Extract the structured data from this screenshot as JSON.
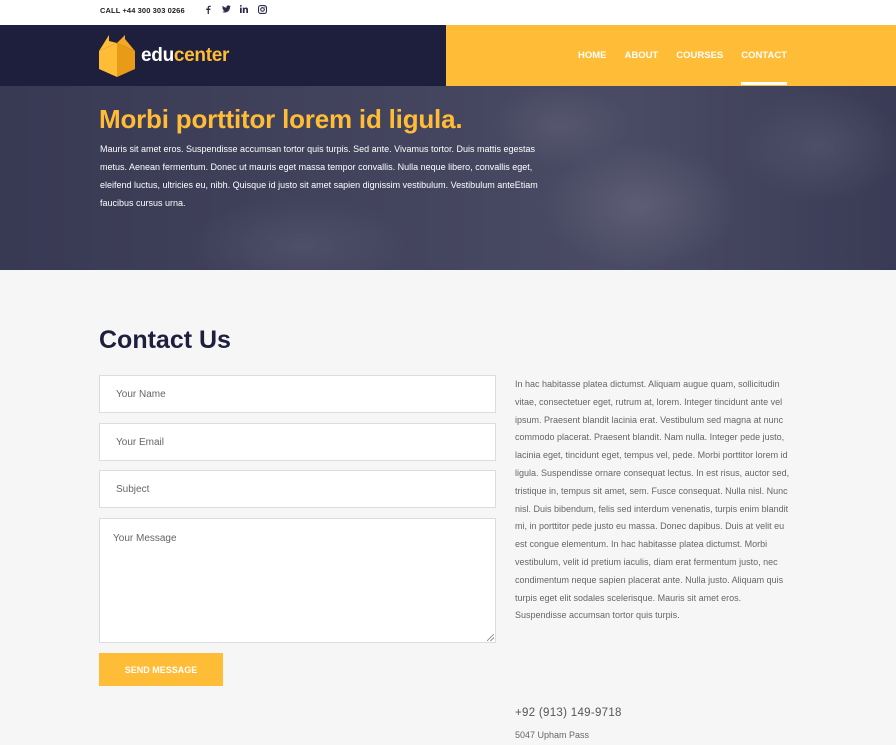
{
  "topbar": {
    "call": "CALL +44 300 303 0266",
    "socials": [
      "facebook-icon",
      "twitter-icon",
      "linkedin-icon",
      "instagram-icon"
    ]
  },
  "header": {
    "logo_part1": "edu",
    "logo_part2": "center",
    "nav": [
      "HOME",
      "ABOUT",
      "COURSES",
      "CONTACT"
    ],
    "active": "CONTACT",
    "colors": {
      "dark": "#1e1f3d",
      "accent": "#ffbc36"
    }
  },
  "hero": {
    "title": "Morbi porttitor lorem id ligula.",
    "text": "Mauris sit amet eros. Suspendisse accumsan tortor quis turpis. Sed ante. Vivamus tortor. Duis mattis egestas metus. Aenean fermentum. Donec ut mauris eget massa tempor convallis. Nulla neque libero, convallis eget, eleifend luctus, ultricies eu, nibh. Quisque id justo sit amet sapien dignissim vestibulum. Vestibulum anteEtiam faucibus cursus urna."
  },
  "contact": {
    "title": "Contact Us",
    "name_placeholder": "Your Name",
    "email_placeholder": "Your Email",
    "subject_placeholder": "Subject",
    "message_placeholder": "Your Message",
    "send_label": "SEND MESSAGE",
    "side_text": "In hac habitasse platea dictumst. Aliquam augue quam, sollicitudin vitae, consectetuer eget, rutrum at, lorem. Integer tincidunt ante vel ipsum. Praesent blandit lacinia erat. Vestibulum sed magna at nunc commodo placerat. Praesent blandit. Nam nulla. Integer pede justo, lacinia eget, tincidunt eget, tempus vel, pede. Morbi porttitor lorem id ligula. Suspendisse ornare consequat lectus. In est risus, auctor sed, tristique in, tempus sit amet, sem. Fusce consequat. Nulla nisl. Nunc nisl. Duis bibendum, felis sed interdum venenatis, turpis enim blandit mi, in porttitor pede justo eu massa. Donec dapibus. Duis at velit eu est congue elementum. In hac habitasse platea dictumst. Morbi vestibulum, velit id pretium iaculis, diam erat fermentum justo, nec condimentum neque sapien placerat ante. Nulla justo. Aliquam quis turpis eget elit sodales scelerisque. Mauris sit amet eros. Suspendisse accumsan tortor quis turpis.",
    "phone": "+92 (913) 149-9718",
    "address": "5047 Upham Pass"
  }
}
